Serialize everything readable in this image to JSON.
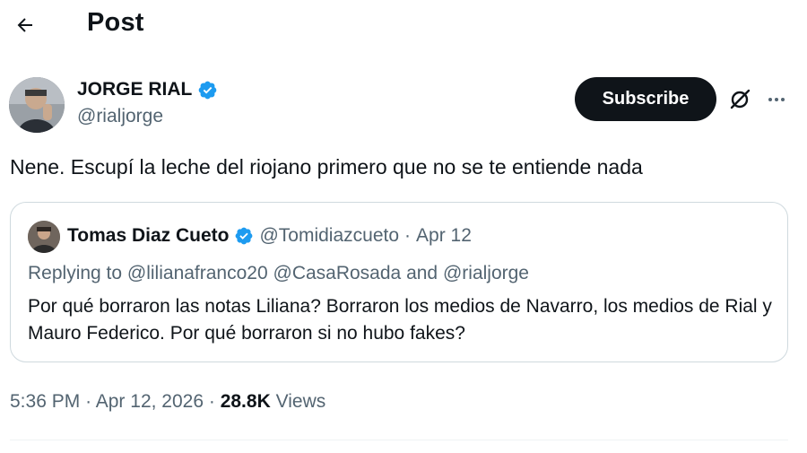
{
  "header": {
    "title": "Post",
    "back_icon": "arrow-left-icon"
  },
  "author": {
    "name": "JORGE RIAL",
    "handle": "@rialjorge",
    "verified_color": "#1d9bf0"
  },
  "actions": {
    "subscribe_label": "Subscribe",
    "grok_icon": "grok-icon",
    "more_icon": "more-icon"
  },
  "post": {
    "text": "Nene. Escupí la leche del riojano primero que no se te entiende nada"
  },
  "quote": {
    "name": "Tomas Diaz Cueto",
    "handle": "@Tomidiazcueto",
    "separator": "·",
    "date": "Apr 12",
    "replying_prefix": "Replying to",
    "mention_1": "@lilianafranco20",
    "mention_2": "@CasaRosada",
    "and_word": "and",
    "mention_3": "@rialjorge",
    "text": "Por qué borraron las notas Liliana? Borraron los medios de Navarro, los medios de Rial y Mauro Federico. Por qué borraron si no hubo fakes?"
  },
  "meta": {
    "time": "5:36 PM",
    "sep1": "·",
    "date": "Apr 12, 2026",
    "sep2": "·",
    "views_count": "28.8K",
    "views_label": "Views"
  }
}
